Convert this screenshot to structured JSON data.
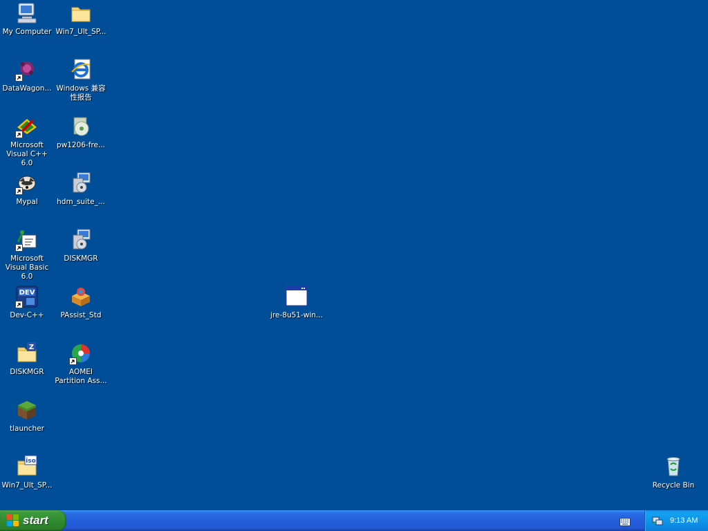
{
  "desktop": {
    "icons": [
      {
        "label": "My Computer",
        "icon": "computer-icon"
      },
      {
        "label": "Win7_Ult_SP...",
        "icon": "folder-icon"
      },
      {
        "label": "DataWagon...",
        "icon": "datawagon-icon"
      },
      {
        "label": "Windows 兼容性报告",
        "icon": "internet-explorer-icon"
      },
      {
        "label": "Microsoft Visual C++ 6.0",
        "icon": "visual-cpp-icon"
      },
      {
        "label": "pw1206-fre...",
        "icon": "cd-installer-icon"
      },
      {
        "label": "Mypal",
        "icon": "mypal-icon"
      },
      {
        "label": "hdm_suite_...",
        "icon": "setup-installer-icon"
      },
      {
        "label": "Microsoft Visual Basic 6.0",
        "icon": "visual-basic-icon"
      },
      {
        "label": "DISKMGR",
        "icon": "setup-installer-icon"
      },
      {
        "label": "Dev-C++",
        "icon": "dev-cpp-icon"
      },
      {
        "label": "PAssist_Std",
        "icon": "package-icon"
      },
      {
        "label": "DISKMGR",
        "icon": "zip-folder-icon"
      },
      {
        "label": "AOMEI Partition Ass...",
        "icon": "aomei-icon"
      },
      {
        "label": "tlauncher",
        "icon": "grass-block-icon"
      },
      {
        "label": "Win7_Ult_SP...",
        "icon": "iso-file-icon"
      },
      {
        "label": "jre-8u51-win...",
        "icon": "application-window-icon"
      },
      {
        "label": "Recycle Bin",
        "icon": "recycle-bin-icon"
      }
    ]
  },
  "taskbar": {
    "start_label": "start",
    "clock": "9:13 AM",
    "tray_icon": "network-icon",
    "language_icon": "keyboard-icon"
  }
}
